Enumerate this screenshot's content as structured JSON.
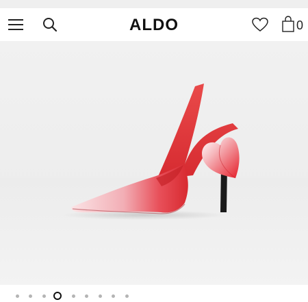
{
  "header": {
    "logo": "ALDO",
    "cart_count": "0"
  },
  "icons": {
    "menu": "hamburger-menu-icon",
    "search": "search-icon",
    "wishlist": "heart-icon",
    "cart": "shopping-bag-icon"
  },
  "carousel": {
    "total_slides": 9,
    "active_index": 3
  },
  "colors": {
    "shoe_red": "#e23a3a",
    "shoe_pink": "#f7d3d6",
    "background": "#f1f1f1"
  }
}
